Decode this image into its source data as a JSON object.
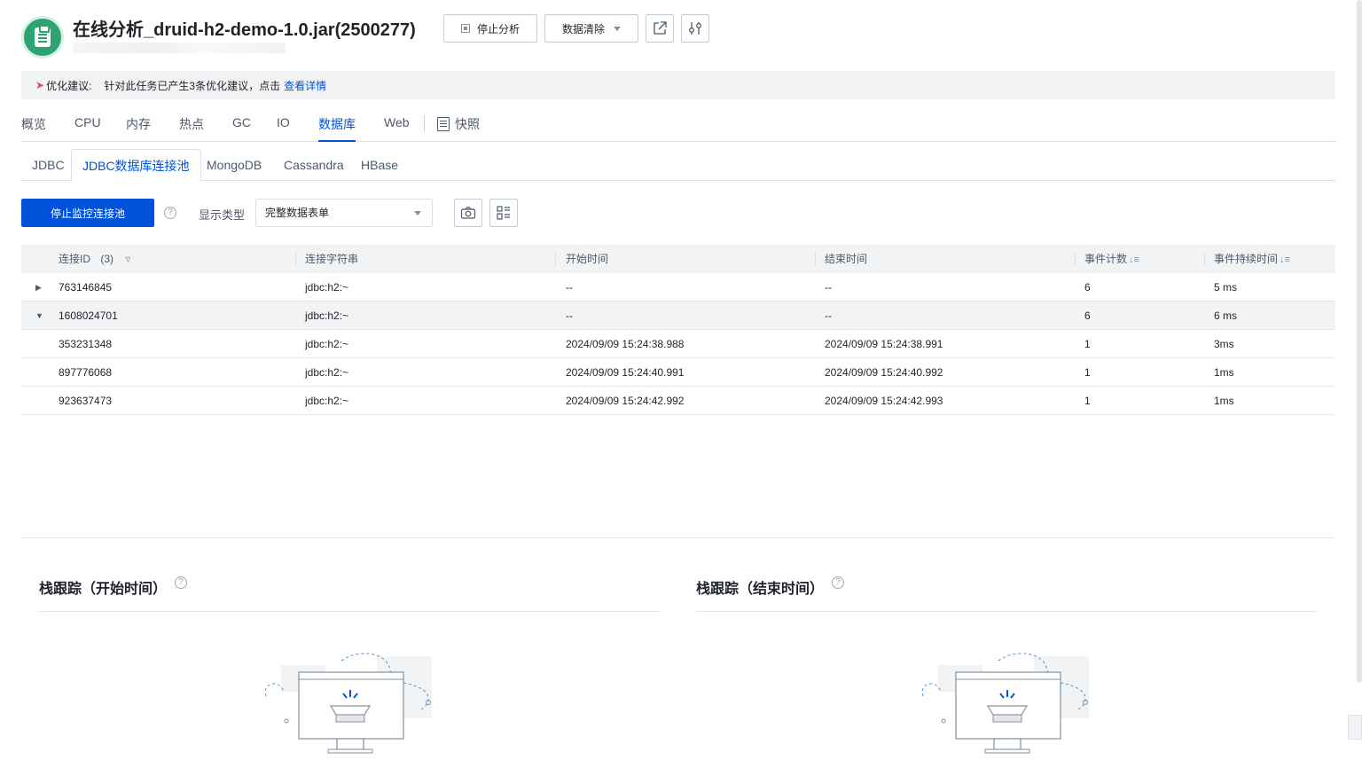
{
  "header": {
    "title": "在线分析_druid-h2-demo-1.0.jar(2500277)",
    "stop_label": "停止分析",
    "clear_label": "数据清除"
  },
  "tips": {
    "label": "优化建议:",
    "text": "针对此任务已产生3条优化建议，点击",
    "link": "查看详情"
  },
  "main_tabs": [
    "概览",
    "CPU",
    "内存",
    "热点",
    "GC",
    "IO",
    "数据库",
    "Web",
    "快照"
  ],
  "main_tabs_active": "数据库",
  "sub_tabs": [
    "JDBC",
    "JDBC数据库连接池",
    "MongoDB",
    "Cassandra",
    "HBase"
  ],
  "sub_tabs_active": "JDBC数据库连接池",
  "toolbar": {
    "primary_label": "停止监控连接池",
    "display_label": "显示类型",
    "select_value": "完整数据表单"
  },
  "table": {
    "columns": [
      "连接ID",
      "连接字符串",
      "开始时间",
      "结束时间",
      "事件计数",
      "事件持续时间"
    ],
    "id_count": "(3)",
    "rows": [
      {
        "id": "763146845",
        "conn": "jdbc:h2:~",
        "start": "--",
        "end": "--",
        "count": "6",
        "duration": "5 ms",
        "expand": "▶"
      },
      {
        "id": "1608024701",
        "conn": "jdbc:h2:~",
        "start": "--",
        "end": "--",
        "count": "6",
        "duration": "6 ms",
        "expand": "▼"
      },
      {
        "id": "353231348",
        "conn": "jdbc:h2:~",
        "start": "2024/09/09 15:24:38.988",
        "end": "2024/09/09 15:24:38.991",
        "count": "1",
        "duration": "3ms",
        "expand": ""
      },
      {
        "id": "897776068",
        "conn": "jdbc:h2:~",
        "start": "2024/09/09 15:24:40.991",
        "end": "2024/09/09 15:24:40.992",
        "count": "1",
        "duration": "1ms",
        "expand": ""
      },
      {
        "id": "923637473",
        "conn": "jdbc:h2:~",
        "start": "2024/09/09 15:24:42.992",
        "end": "2024/09/09 15:24:42.993",
        "count": "1",
        "duration": "1ms",
        "expand": ""
      }
    ]
  },
  "panels": {
    "start_title": "栈跟踪（开始时间）",
    "end_title": "栈跟踪（结束时间）"
  },
  "colors": {
    "primary": "#0052d9",
    "success": "#2ba471",
    "row_highlight": "#f2f3f5"
  }
}
